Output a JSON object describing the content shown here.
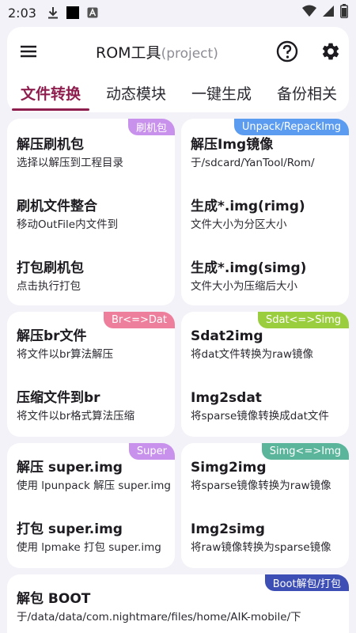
{
  "status_bar": {
    "time": "2:03",
    "icons": [
      "download-icon",
      "black-square-icon",
      "a-box-icon"
    ],
    "right_icons": [
      "wifi-icon",
      "signal-icon",
      "battery-icon"
    ]
  },
  "app_bar": {
    "title": "ROM工具",
    "subtitle": "(project)",
    "menu_icon": "hamburger-menu-icon",
    "help_icon": "help-circle-icon",
    "settings_icon": "gear-icon"
  },
  "tabs": [
    {
      "label": "文件转换",
      "active": true
    },
    {
      "label": "动态模块",
      "active": false
    },
    {
      "label": "一键生成",
      "active": false
    },
    {
      "label": "备份相关",
      "active": false
    }
  ],
  "cards": {
    "flash_pkg": {
      "badge": "刷机包",
      "badge_color": "#c892ec",
      "items": [
        {
          "title": "解压刷机包",
          "desc": "选择以解压到工程目录"
        },
        {
          "title": "刷机文件整合",
          "desc": "移动OutFile内文件到"
        },
        {
          "title": "打包刷机包",
          "desc": "点击执行打包"
        }
      ]
    },
    "unpack_img": {
      "badge": "Unpack/RepackImg",
      "badge_color": "#5b9cf0",
      "items": [
        {
          "title": "解压Img镜像",
          "desc": "于/sdcard/YanTool/Rom/"
        },
        {
          "title": "生成*.img(rimg)",
          "desc": "文件大小为分区大小"
        },
        {
          "title": "生成*.img(simg)",
          "desc": "文件大小为压缩后大小"
        }
      ]
    },
    "br_dat": {
      "badge": "Br<=>Dat",
      "badge_color": "#ee7f9c",
      "items": [
        {
          "title": "解压br文件",
          "desc": "将文件以br算法解压"
        },
        {
          "title": "压缩文件到br",
          "desc": "将文件以br格式算法压缩"
        }
      ]
    },
    "sdat_simg": {
      "badge": "Sdat<=>Simg",
      "badge_color": "#9bce3e",
      "items": [
        {
          "title": "Sdat2img",
          "desc": "将dat文件转换为raw镜像"
        },
        {
          "title": "Img2sdat",
          "desc": "将sparse镜像转换成dat文件"
        }
      ]
    },
    "super": {
      "badge": "Super",
      "badge_color": "#c892ec",
      "items": [
        {
          "title": "解压 super.img",
          "desc": "使用 lpunpack 解压 super.img"
        },
        {
          "title": "打包 super.img",
          "desc": "使用 lpmake 打包 super.img"
        }
      ]
    },
    "simg_img": {
      "badge": "Simg<=>Img",
      "badge_color": "#5ab59a",
      "items": [
        {
          "title": "Simg2img",
          "desc": "将sparse镜像转换为raw镜像"
        },
        {
          "title": "Img2simg",
          "desc": "将raw镜像转换为sparse镜像"
        }
      ]
    },
    "boot": {
      "badge": "Boot解包/打包",
      "badge_color": "#3d4fb5",
      "items": [
        {
          "title": "解包 BOOT",
          "desc": "于/data/data/com.nightmare/files/home/AIK-mobile/下"
        }
      ]
    }
  },
  "colors": {
    "accent": "#8e1e4e",
    "background": "#f3f2f8",
    "card": "#ffffff"
  }
}
